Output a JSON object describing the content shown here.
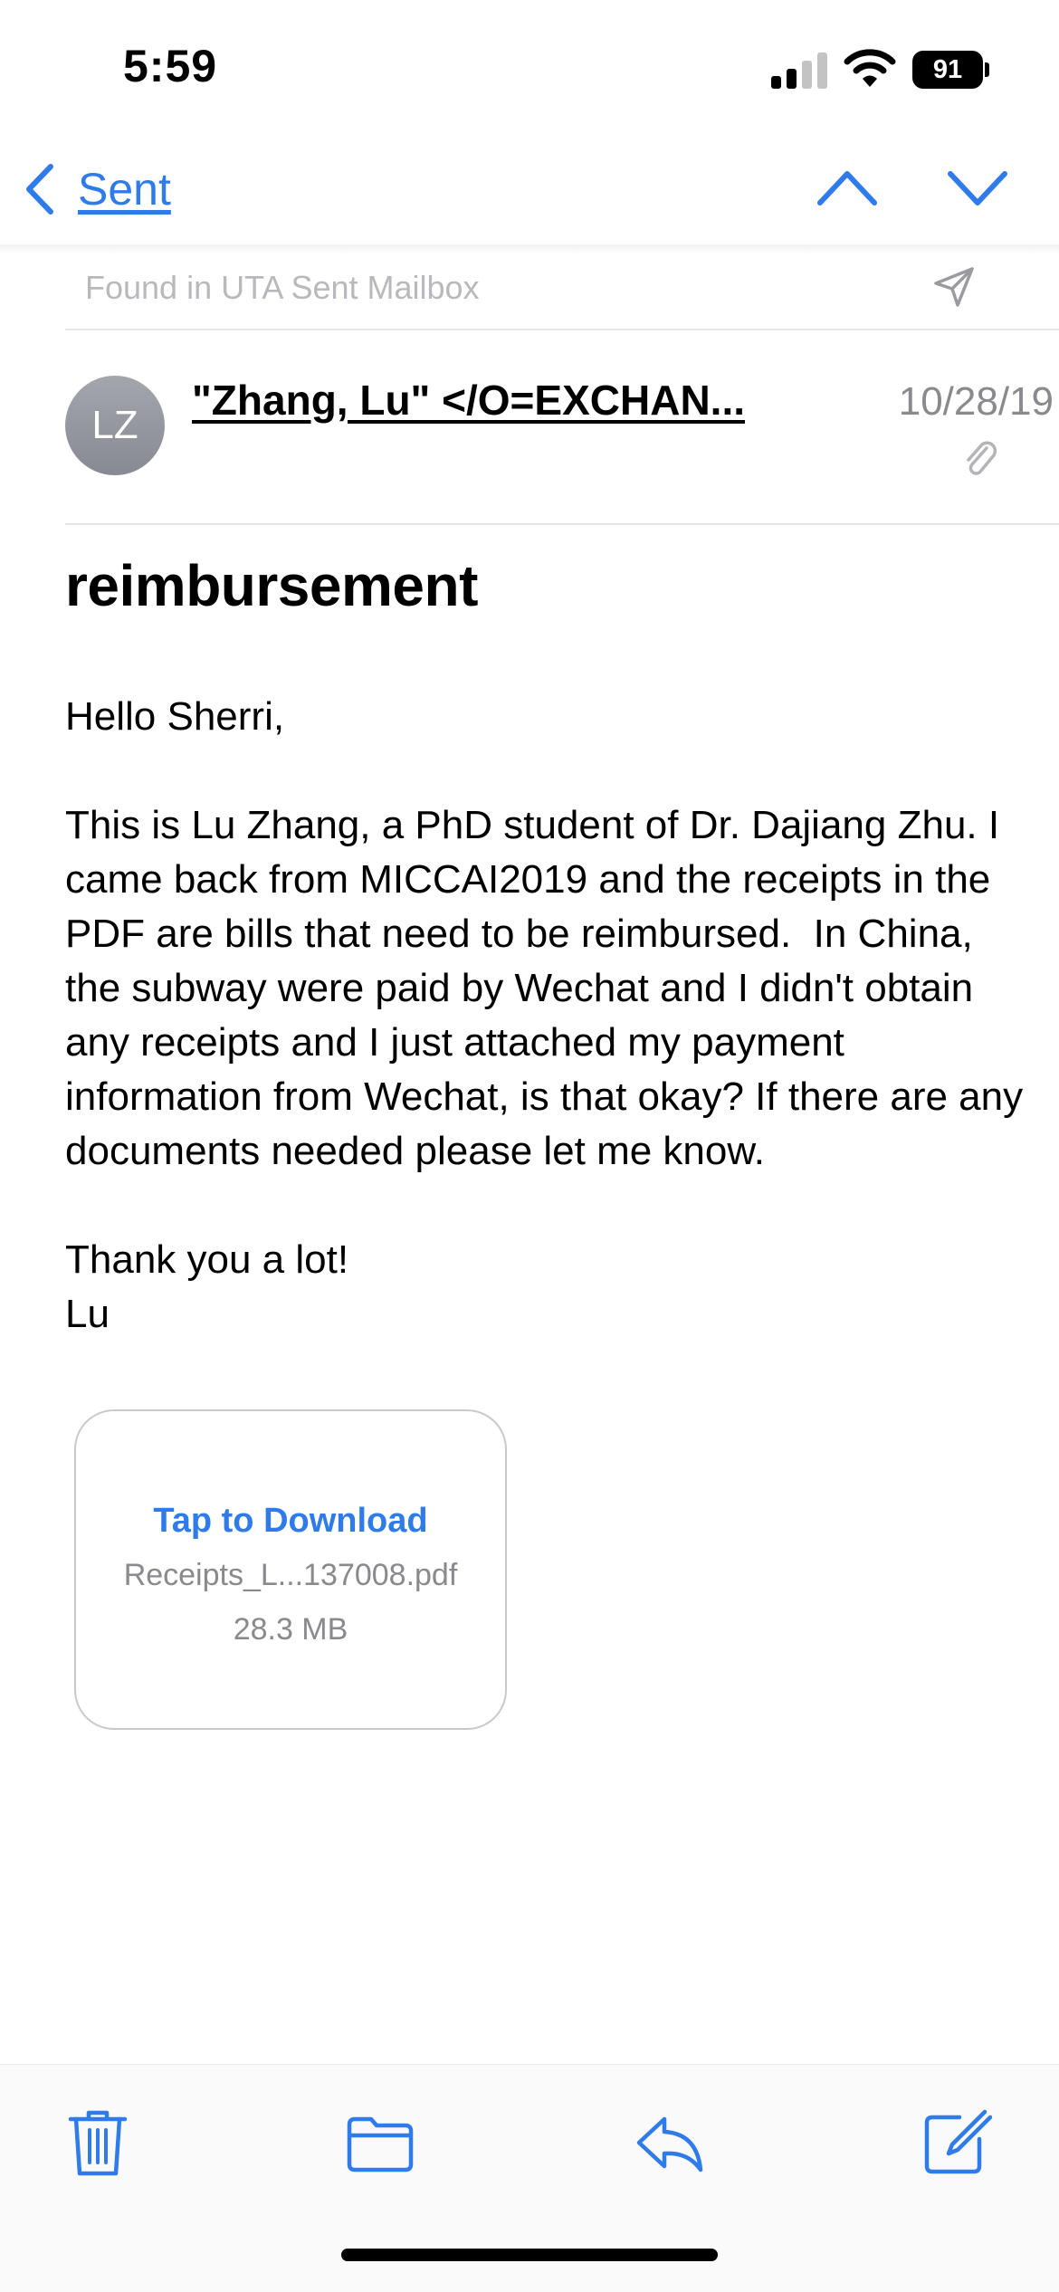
{
  "status_bar": {
    "time": "5:59",
    "battery_level": "91",
    "icons": [
      "cellular-signal-icon",
      "wifi-icon",
      "battery-icon"
    ]
  },
  "nav": {
    "back_label": "Sent",
    "icons": [
      "chevron-left-icon",
      "chevron-up-icon",
      "chevron-down-icon"
    ]
  },
  "banner": {
    "found_in": "Found in UTA Sent Mailbox",
    "icon": "paper-plane-icon"
  },
  "message": {
    "avatar_initials": "LZ",
    "sender": "\"Zhang, Lu\" </O=EXCHAN...",
    "date": "10/28/19",
    "subject": "reimbursement",
    "body": "Hello Sherri,\n\nThis is Lu Zhang, a PhD student of Dr. Dajiang Zhu. I came back from MICCAI2019 and the receipts in the PDF are bills that need to be reimbursed.  In China, the subway were paid by Wechat and I didn't obtain any receipts and I just attached my payment information from Wechat, is that okay? If there are any documents needed please let me know.\n\nThank you a lot!\nLu"
  },
  "attachment": {
    "action_label": "Tap to Download",
    "file_name": "Receipts_L...137008.pdf",
    "file_size": "28.3 MB"
  },
  "toolbar": {
    "icons": [
      "trash-icon",
      "folder-icon",
      "reply-icon",
      "compose-icon"
    ]
  },
  "colors": {
    "accent": "#2f7bea",
    "secondary_text": "#8a8a8e",
    "avatar": "#9a9ca3"
  }
}
